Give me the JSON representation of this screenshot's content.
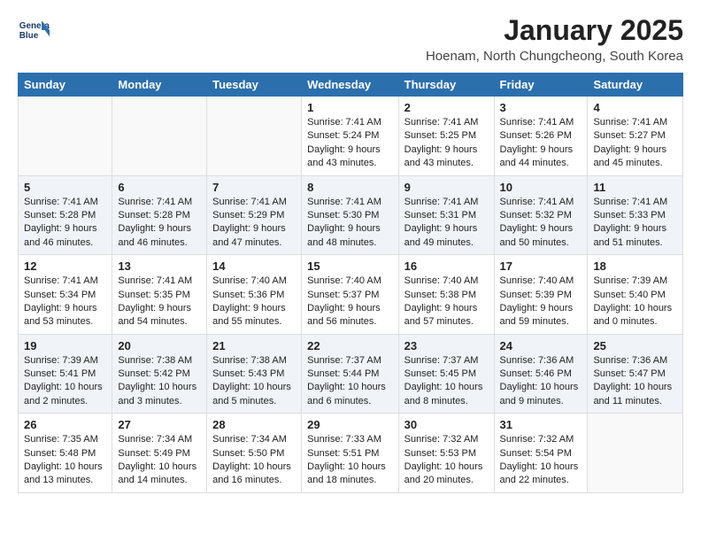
{
  "header": {
    "logo_line1": "General",
    "logo_line2": "Blue",
    "month": "January 2025",
    "location": "Hoenam, North Chungcheong, South Korea"
  },
  "weekdays": [
    "Sunday",
    "Monday",
    "Tuesday",
    "Wednesday",
    "Thursday",
    "Friday",
    "Saturday"
  ],
  "weeks": [
    [
      {
        "day": "",
        "content": ""
      },
      {
        "day": "",
        "content": ""
      },
      {
        "day": "",
        "content": ""
      },
      {
        "day": "1",
        "content": "Sunrise: 7:41 AM\nSunset: 5:24 PM\nDaylight: 9 hours and 43 minutes."
      },
      {
        "day": "2",
        "content": "Sunrise: 7:41 AM\nSunset: 5:25 PM\nDaylight: 9 hours and 43 minutes."
      },
      {
        "day": "3",
        "content": "Sunrise: 7:41 AM\nSunset: 5:26 PM\nDaylight: 9 hours and 44 minutes."
      },
      {
        "day": "4",
        "content": "Sunrise: 7:41 AM\nSunset: 5:27 PM\nDaylight: 9 hours and 45 minutes."
      }
    ],
    [
      {
        "day": "5",
        "content": "Sunrise: 7:41 AM\nSunset: 5:28 PM\nDaylight: 9 hours and 46 minutes."
      },
      {
        "day": "6",
        "content": "Sunrise: 7:41 AM\nSunset: 5:28 PM\nDaylight: 9 hours and 46 minutes."
      },
      {
        "day": "7",
        "content": "Sunrise: 7:41 AM\nSunset: 5:29 PM\nDaylight: 9 hours and 47 minutes."
      },
      {
        "day": "8",
        "content": "Sunrise: 7:41 AM\nSunset: 5:30 PM\nDaylight: 9 hours and 48 minutes."
      },
      {
        "day": "9",
        "content": "Sunrise: 7:41 AM\nSunset: 5:31 PM\nDaylight: 9 hours and 49 minutes."
      },
      {
        "day": "10",
        "content": "Sunrise: 7:41 AM\nSunset: 5:32 PM\nDaylight: 9 hours and 50 minutes."
      },
      {
        "day": "11",
        "content": "Sunrise: 7:41 AM\nSunset: 5:33 PM\nDaylight: 9 hours and 51 minutes."
      }
    ],
    [
      {
        "day": "12",
        "content": "Sunrise: 7:41 AM\nSunset: 5:34 PM\nDaylight: 9 hours and 53 minutes."
      },
      {
        "day": "13",
        "content": "Sunrise: 7:41 AM\nSunset: 5:35 PM\nDaylight: 9 hours and 54 minutes."
      },
      {
        "day": "14",
        "content": "Sunrise: 7:40 AM\nSunset: 5:36 PM\nDaylight: 9 hours and 55 minutes."
      },
      {
        "day": "15",
        "content": "Sunrise: 7:40 AM\nSunset: 5:37 PM\nDaylight: 9 hours and 56 minutes."
      },
      {
        "day": "16",
        "content": "Sunrise: 7:40 AM\nSunset: 5:38 PM\nDaylight: 9 hours and 57 minutes."
      },
      {
        "day": "17",
        "content": "Sunrise: 7:40 AM\nSunset: 5:39 PM\nDaylight: 9 hours and 59 minutes."
      },
      {
        "day": "18",
        "content": "Sunrise: 7:39 AM\nSunset: 5:40 PM\nDaylight: 10 hours and 0 minutes."
      }
    ],
    [
      {
        "day": "19",
        "content": "Sunrise: 7:39 AM\nSunset: 5:41 PM\nDaylight: 10 hours and 2 minutes."
      },
      {
        "day": "20",
        "content": "Sunrise: 7:38 AM\nSunset: 5:42 PM\nDaylight: 10 hours and 3 minutes."
      },
      {
        "day": "21",
        "content": "Sunrise: 7:38 AM\nSunset: 5:43 PM\nDaylight: 10 hours and 5 minutes."
      },
      {
        "day": "22",
        "content": "Sunrise: 7:37 AM\nSunset: 5:44 PM\nDaylight: 10 hours and 6 minutes."
      },
      {
        "day": "23",
        "content": "Sunrise: 7:37 AM\nSunset: 5:45 PM\nDaylight: 10 hours and 8 minutes."
      },
      {
        "day": "24",
        "content": "Sunrise: 7:36 AM\nSunset: 5:46 PM\nDaylight: 10 hours and 9 minutes."
      },
      {
        "day": "25",
        "content": "Sunrise: 7:36 AM\nSunset: 5:47 PM\nDaylight: 10 hours and 11 minutes."
      }
    ],
    [
      {
        "day": "26",
        "content": "Sunrise: 7:35 AM\nSunset: 5:48 PM\nDaylight: 10 hours and 13 minutes."
      },
      {
        "day": "27",
        "content": "Sunrise: 7:34 AM\nSunset: 5:49 PM\nDaylight: 10 hours and 14 minutes."
      },
      {
        "day": "28",
        "content": "Sunrise: 7:34 AM\nSunset: 5:50 PM\nDaylight: 10 hours and 16 minutes."
      },
      {
        "day": "29",
        "content": "Sunrise: 7:33 AM\nSunset: 5:51 PM\nDaylight: 10 hours and 18 minutes."
      },
      {
        "day": "30",
        "content": "Sunrise: 7:32 AM\nSunset: 5:53 PM\nDaylight: 10 hours and 20 minutes."
      },
      {
        "day": "31",
        "content": "Sunrise: 7:32 AM\nSunset: 5:54 PM\nDaylight: 10 hours and 22 minutes."
      },
      {
        "day": "",
        "content": ""
      }
    ]
  ]
}
